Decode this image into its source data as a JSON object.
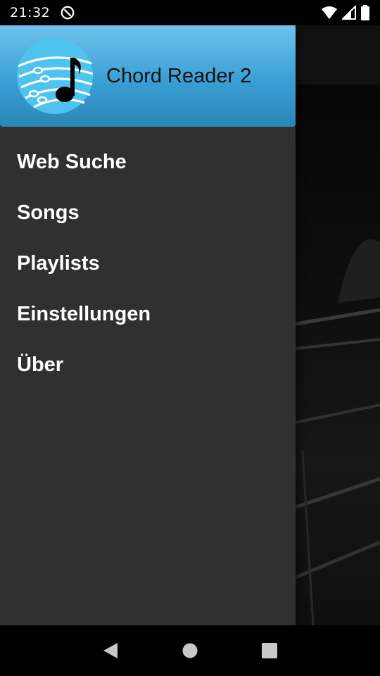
{
  "status_bar": {
    "time": "21:32",
    "icons": [
      "at-sign-icon",
      "wifi-icon",
      "signal-icon",
      "battery-icon"
    ]
  },
  "drawer": {
    "app_title": "Chord Reader 2",
    "logo_icon": "music-note-staff-logo",
    "header_color": "#3a9fd4",
    "background_color": "#303030",
    "menu_items": [
      {
        "label": "Web Suche"
      },
      {
        "label": "Songs"
      },
      {
        "label": "Playlists"
      },
      {
        "label": "Einstellungen"
      },
      {
        "label": "Über"
      }
    ]
  },
  "nav_bar": {
    "buttons": [
      "back-icon",
      "home-icon",
      "recents-icon"
    ]
  }
}
